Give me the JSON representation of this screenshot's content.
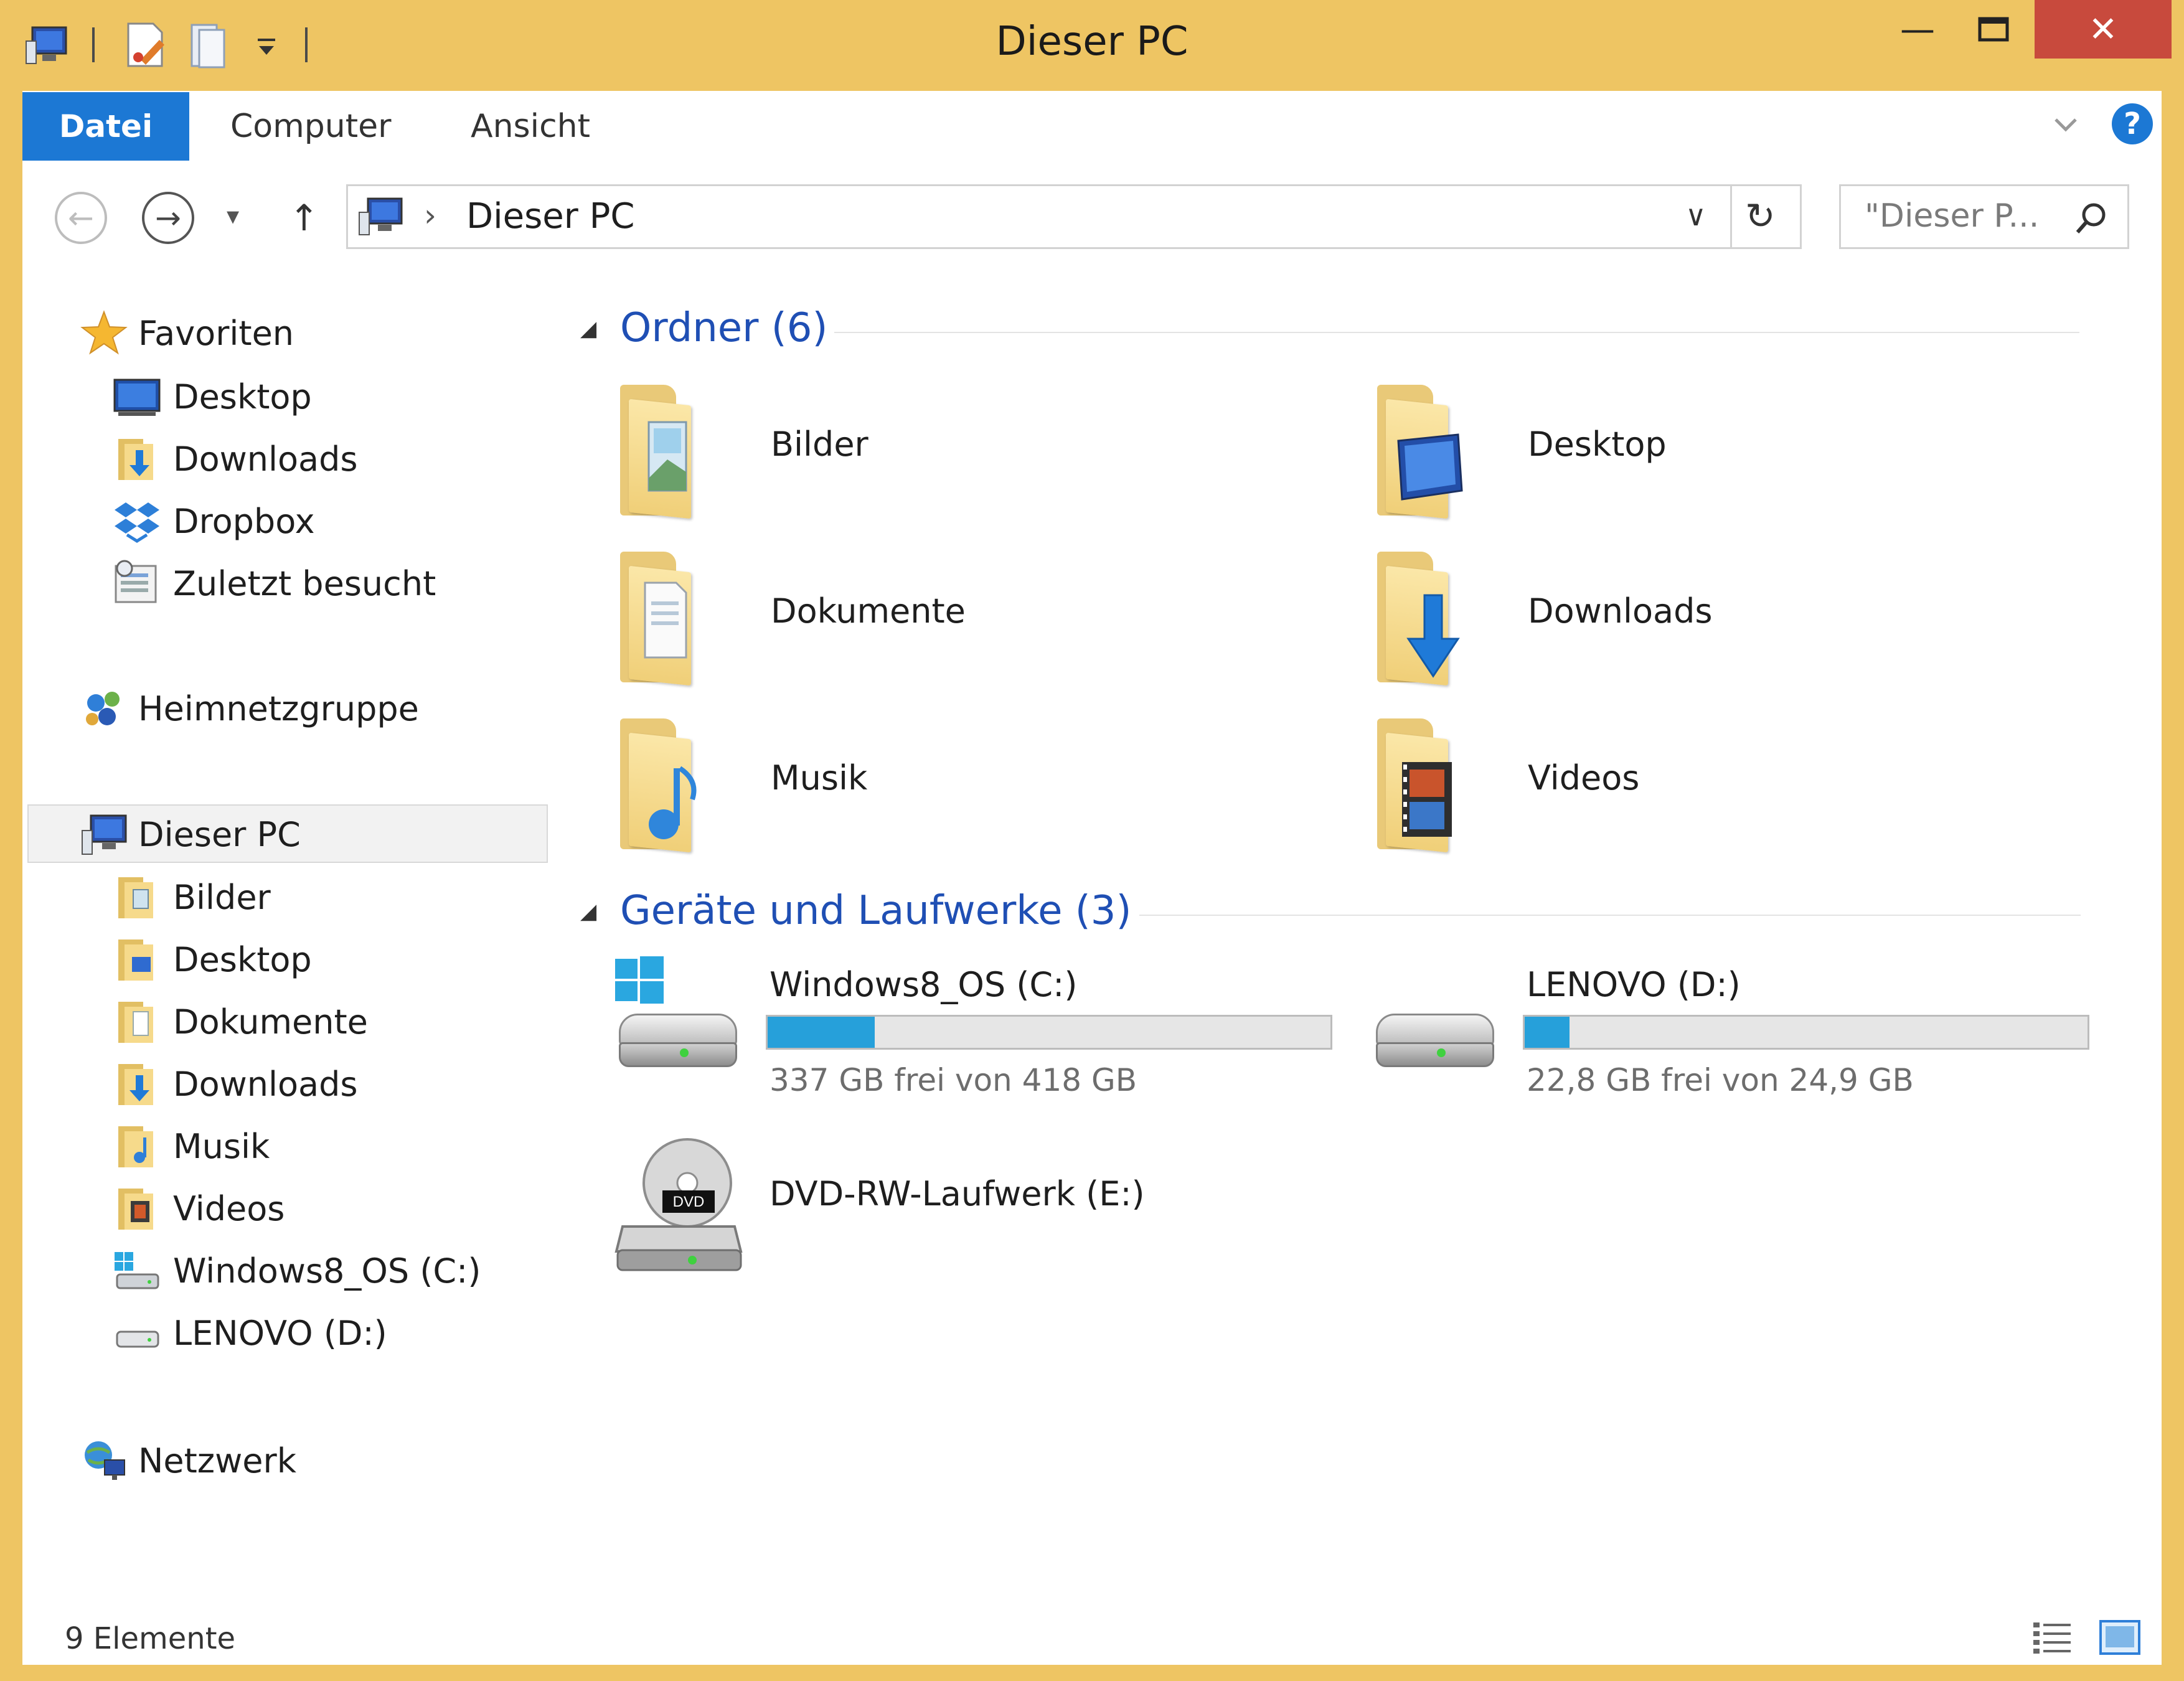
{
  "window": {
    "title": "Dieser PC",
    "close_symbol": "✕",
    "minimize_symbol": "—",
    "maximize_symbol": "☐"
  },
  "ribbon": {
    "tabs": [
      {
        "label": "Datei",
        "active": true
      },
      {
        "label": "Computer"
      },
      {
        "label": "Ansicht"
      }
    ],
    "help_symbol": "?"
  },
  "address": {
    "back_symbol": "←",
    "forward_symbol": "→",
    "recent_symbol": "▾",
    "up_symbol": "↑",
    "crumb_sep": "›",
    "location": "Dieser PC",
    "dropdown_symbol": "∨",
    "refresh_symbol": "↻",
    "search_placeholder": "\"Dieser P...",
    "search_symbol": "⌕"
  },
  "nav": {
    "favorites": {
      "label": "Favoriten",
      "items": [
        "Desktop",
        "Downloads",
        "Dropbox",
        "Zuletzt besucht"
      ]
    },
    "homegroup": "Heimnetzgruppe",
    "this_pc": {
      "label": "Dieser PC",
      "items": [
        "Bilder",
        "Desktop",
        "Dokumente",
        "Downloads",
        "Musik",
        "Videos",
        "Windows8_OS (C:)",
        "LENOVO (D:)"
      ]
    },
    "network": "Netzwerk"
  },
  "content": {
    "folders_section": "Ordner (6)",
    "folders": [
      "Bilder",
      "Desktop",
      "Dokumente",
      "Downloads",
      "Musik",
      "Videos"
    ],
    "devices_section": "Geräte und Laufwerke (3)",
    "drives": [
      {
        "name": "Windows8_OS (C:)",
        "free": "337 GB frei von 418 GB",
        "used_fraction": 0.19
      },
      {
        "name": "LENOVO (D:)",
        "free": "22,8 GB frei von 24,9 GB",
        "used_fraction": 0.08
      },
      {
        "name": "DVD-RW-Laufwerk (E:)"
      }
    ],
    "expand_symbol": "◢"
  },
  "status": {
    "count": "9 Elemente"
  },
  "colors": {
    "frame": "#eec563",
    "accent": "#1c78d4",
    "section_title": "#1f4fb4",
    "bar_fill": "#26a0da",
    "close": "#c84a3d"
  }
}
